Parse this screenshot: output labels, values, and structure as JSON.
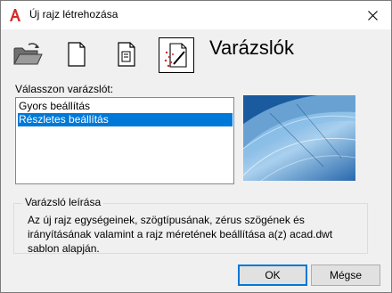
{
  "window": {
    "title": "Új rajz létrehozása",
    "close_icon": "close-icon"
  },
  "toolbar": {
    "icons": [
      "open-folder-icon",
      "blank-page-icon",
      "template-page-icon",
      "wizard-icon"
    ]
  },
  "heading": "Varázslók",
  "wizard_list": {
    "label": "Válasszon varázslót:",
    "items": [
      "Gyors beállítás",
      "Részletes beállítás"
    ],
    "selected": "Részletes beállítás"
  },
  "description": {
    "label": "Varázsló leírása",
    "text": "Az új rajz egységeinek, szögtípusának, zérus szögének és irányításának valamint a rajz méretének beállítása a(z) acad.dwt sablon alapján."
  },
  "buttons": {
    "ok": "OK",
    "cancel": "Mégse"
  },
  "colors": {
    "selection": "#0078d7",
    "preview": "#1f6fb8",
    "app_icon": "#d42a2a"
  }
}
